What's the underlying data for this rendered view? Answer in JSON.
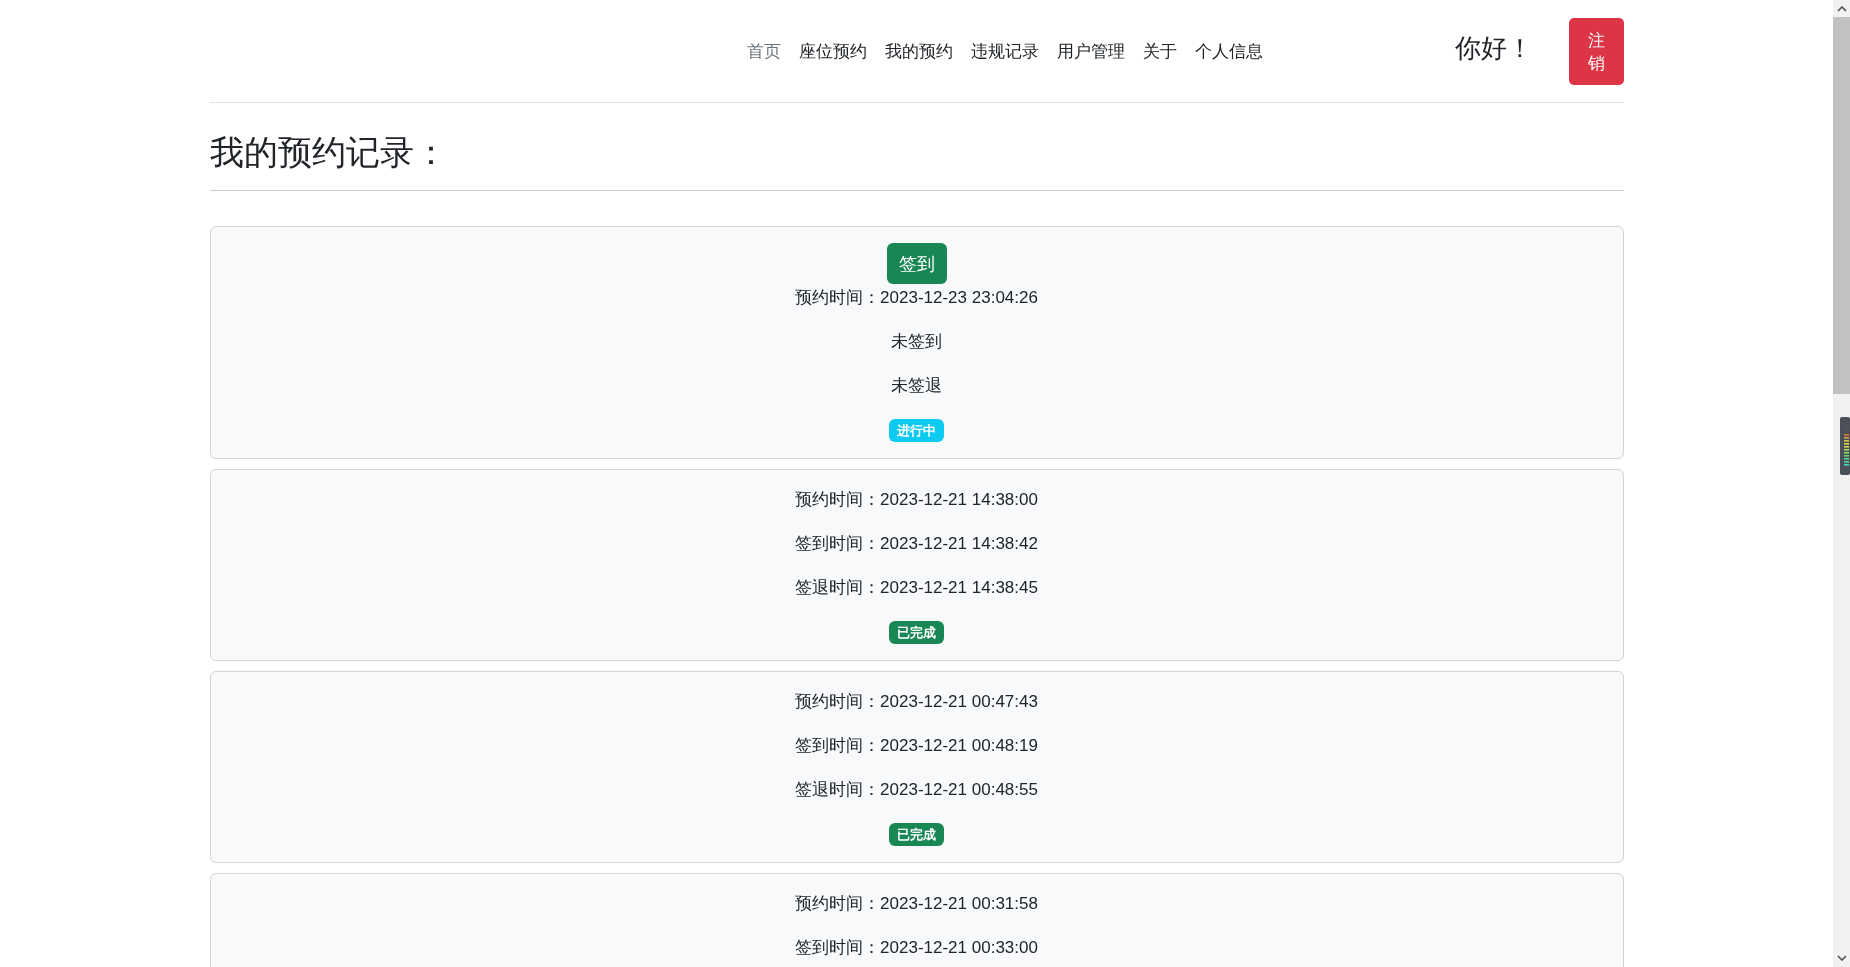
{
  "nav": {
    "items": [
      {
        "label": "首页",
        "selected": true
      },
      {
        "label": "座位预约",
        "selected": false
      },
      {
        "label": "我的预约",
        "selected": false
      },
      {
        "label": "违规记录",
        "selected": false
      },
      {
        "label": "用户管理",
        "selected": false
      },
      {
        "label": "关于",
        "selected": false
      },
      {
        "label": "个人信息",
        "selected": false
      }
    ]
  },
  "greeting": "你好！",
  "logout_button": "注销",
  "page_title": "我的预约记录：",
  "records": [
    {
      "action_button": "签到",
      "lines": [
        "预约时间：2023-12-23 23:04:26",
        "未签到",
        "未签退"
      ],
      "status": {
        "label": "进行中",
        "color": "#0dcaf0"
      }
    },
    {
      "lines": [
        "预约时间：2023-12-21 14:38:00",
        "签到时间：2023-12-21 14:38:42",
        "签退时间：2023-12-21 14:38:45"
      ],
      "status": {
        "label": "已完成",
        "color": "#198754"
      }
    },
    {
      "lines": [
        "预约时间：2023-12-21 00:47:43",
        "签到时间：2023-12-21 00:48:19",
        "签退时间：2023-12-21 00:48:55"
      ],
      "status": {
        "label": "已完成",
        "color": "#198754"
      }
    },
    {
      "lines": [
        "预约时间：2023-12-21 00:31:58",
        "签到时间：2023-12-21 00:33:00"
      ]
    }
  ]
}
